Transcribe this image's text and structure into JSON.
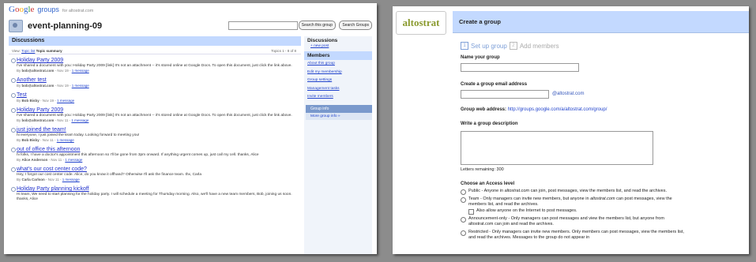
{
  "left": {
    "logo": {
      "g1": "G",
      "g2": "o",
      "g3": "o",
      "g4": "g",
      "g5": "l",
      "g6": "e",
      "groups": "groups",
      "for": "for altostrat.com"
    },
    "group_name": "event-planning-09",
    "search_this_group": "Search this group",
    "search_groups": "Search Groups",
    "discussions_title": "Discussions",
    "view_label": "View:",
    "view_topic_list": "Topic list",
    "view_topic_summary": "Topic summary",
    "topics_count": "Topics 1 - 8 of 8",
    "topics": [
      {
        "title": "Holiday Party 2009",
        "snippet": "I've shared a document with you: Holiday Party 2009 [link] It's not an attachment -- it's stored online at Google Docs. To open this document, just click the link above.",
        "by": "By",
        "author": "bob@altostrat.com",
        "date": " - Nov 19 - ",
        "msgs": "1 message"
      },
      {
        "title": "Another test",
        "snippet": "",
        "by": "By",
        "author": "bob@altostrat.com",
        "date": " - Nov 19 - ",
        "msgs": "1 message"
      },
      {
        "title": "Test",
        "snippet": "",
        "by": "By",
        "author": "Bob Bisby",
        "date": " - Nov 19 - ",
        "msgs": "1 message"
      },
      {
        "title": "Holiday Party 2009",
        "snippet": "I've shared a document with you: Holiday Party 2009 [link] It's not an attachment -- it's stored online at Google Docs. To open this document, just click the link above.",
        "by": "By",
        "author": "bob@altostrat.com",
        "date": " - Nov 11 - ",
        "msgs": "1 message"
      },
      {
        "title": "just joined the team!",
        "snippet": "hi everyone, I just joined the team today. Looking forward to meeting you!",
        "by": "By",
        "author": "Bob Bisby",
        "date": " - Nov 11 - ",
        "msgs": "1 message"
      },
      {
        "title": "out of office this afternoon",
        "snippet": "hi folks, I have a doctor's appointment this afternoon so I'll be gone from 3pm onward. If anything urgent comes up, just call my cell. thanks, Alice",
        "by": "By",
        "author": "Alice Anderson",
        "date": " - Nov 11 - ",
        "msgs": "1 message"
      },
      {
        "title": "what's our cost center code?",
        "snippet": "Hey, I forgot our cost center code. Alice, do you know it offhand? Otherwise I'll ask the finance team. thx, Carla",
        "by": "By",
        "author": "Carla Carlson",
        "date": " - Nov 11 - ",
        "msgs": "1 message"
      },
      {
        "title": "Holiday Party planning kickoff",
        "snippet": "Hi team, We need to start planning for the holiday party. I will schedule a meeting for Thursday morning. Also, we'll have a new team members, Bob, joining us soon. thanks, Alice",
        "by": "",
        "author": "",
        "date": "",
        "msgs": ""
      }
    ],
    "side": {
      "discussions": "Discussions",
      "new_post": "+ new post",
      "members": "Members",
      "links": [
        "About this group",
        "Edit my membership",
        "Group settings",
        "Management tasks",
        "Invite members"
      ],
      "group_info": "Group info",
      "more_info": "More group info »"
    }
  },
  "right": {
    "logo": "altostrat",
    "title": "Create a group",
    "step1_num": "1",
    "step1": "Set up group",
    "step2_num": "2",
    "step2": "Add members",
    "name_label": "Name your group",
    "email_label": "Create a group email address",
    "domain": "@altostrat.com",
    "address_label": "Group web address:",
    "address_url": "http://groups.google.com/a/altostrat.com/group/",
    "desc_label": "Write a group description",
    "remaining": "Letters remaining: 300",
    "access_title": "Choose an Access level",
    "public_a": "Public - Anyone in ",
    "public_dom": "altostrat.com",
    "public_b": " can join, post messages, view the members list, and read the archives.",
    "team_a": "Team - Only managers can invite new members, but anyone in ",
    "team_dom": "altostrat.com",
    "team_b": " can post messages, view the members list, and read the archives.",
    "team_sub": "Also allow anyone on the Internet to post messages.",
    "announce": "Announcement-only - Only managers can post messages and view the members list, but anyone from altostrat.com can join and read the archives.",
    "restricted": "Restricted - Only managers can invite new members. Only members can post messages, view the members list, and read the archives. Messages to the group do not appear in"
  }
}
